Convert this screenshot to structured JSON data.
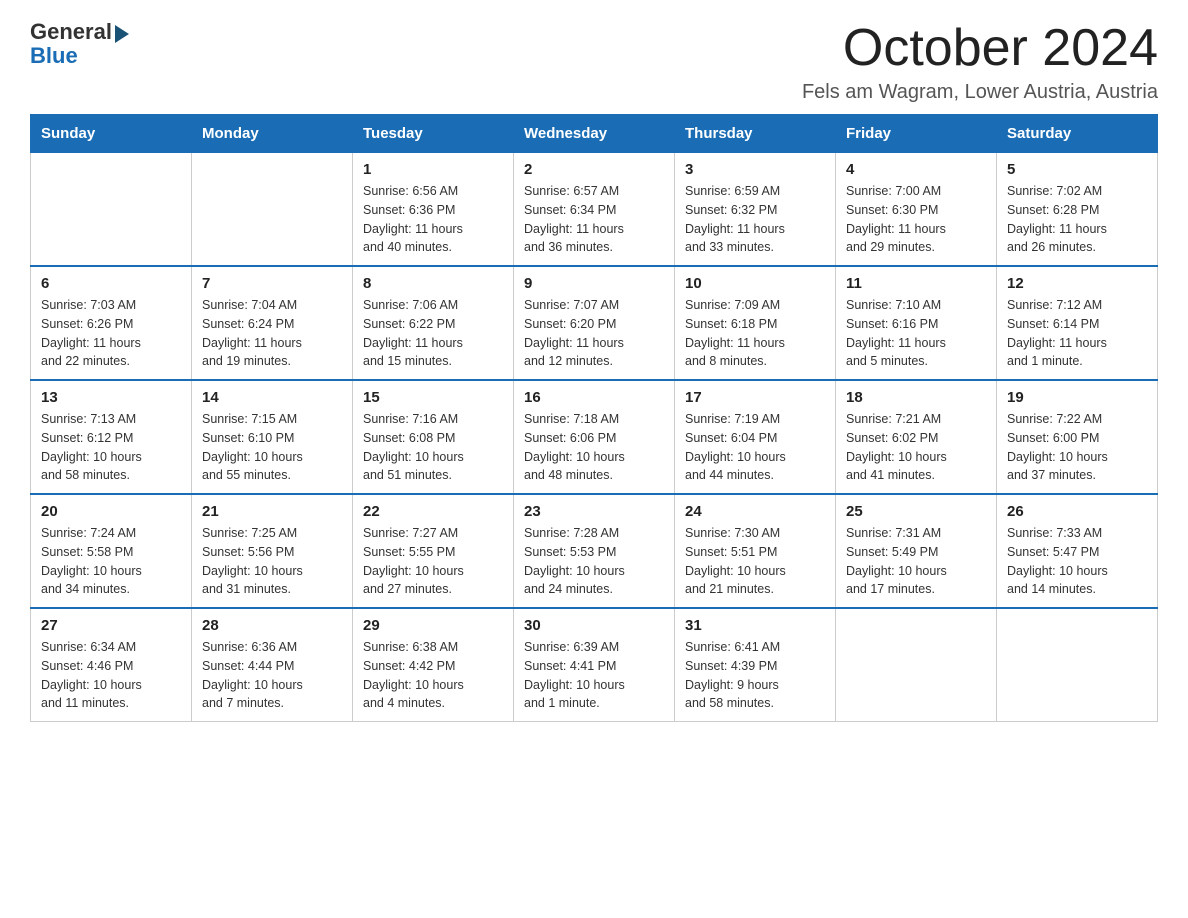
{
  "header": {
    "logo_general": "General",
    "logo_blue": "Blue",
    "month_title": "October 2024",
    "location": "Fels am Wagram, Lower Austria, Austria"
  },
  "days_of_week": [
    "Sunday",
    "Monday",
    "Tuesday",
    "Wednesday",
    "Thursday",
    "Friday",
    "Saturday"
  ],
  "weeks": [
    [
      {
        "day": "",
        "info": ""
      },
      {
        "day": "",
        "info": ""
      },
      {
        "day": "1",
        "info": "Sunrise: 6:56 AM\nSunset: 6:36 PM\nDaylight: 11 hours\nand 40 minutes."
      },
      {
        "day": "2",
        "info": "Sunrise: 6:57 AM\nSunset: 6:34 PM\nDaylight: 11 hours\nand 36 minutes."
      },
      {
        "day": "3",
        "info": "Sunrise: 6:59 AM\nSunset: 6:32 PM\nDaylight: 11 hours\nand 33 minutes."
      },
      {
        "day": "4",
        "info": "Sunrise: 7:00 AM\nSunset: 6:30 PM\nDaylight: 11 hours\nand 29 minutes."
      },
      {
        "day": "5",
        "info": "Sunrise: 7:02 AM\nSunset: 6:28 PM\nDaylight: 11 hours\nand 26 minutes."
      }
    ],
    [
      {
        "day": "6",
        "info": "Sunrise: 7:03 AM\nSunset: 6:26 PM\nDaylight: 11 hours\nand 22 minutes."
      },
      {
        "day": "7",
        "info": "Sunrise: 7:04 AM\nSunset: 6:24 PM\nDaylight: 11 hours\nand 19 minutes."
      },
      {
        "day": "8",
        "info": "Sunrise: 7:06 AM\nSunset: 6:22 PM\nDaylight: 11 hours\nand 15 minutes."
      },
      {
        "day": "9",
        "info": "Sunrise: 7:07 AM\nSunset: 6:20 PM\nDaylight: 11 hours\nand 12 minutes."
      },
      {
        "day": "10",
        "info": "Sunrise: 7:09 AM\nSunset: 6:18 PM\nDaylight: 11 hours\nand 8 minutes."
      },
      {
        "day": "11",
        "info": "Sunrise: 7:10 AM\nSunset: 6:16 PM\nDaylight: 11 hours\nand 5 minutes."
      },
      {
        "day": "12",
        "info": "Sunrise: 7:12 AM\nSunset: 6:14 PM\nDaylight: 11 hours\nand 1 minute."
      }
    ],
    [
      {
        "day": "13",
        "info": "Sunrise: 7:13 AM\nSunset: 6:12 PM\nDaylight: 10 hours\nand 58 minutes."
      },
      {
        "day": "14",
        "info": "Sunrise: 7:15 AM\nSunset: 6:10 PM\nDaylight: 10 hours\nand 55 minutes."
      },
      {
        "day": "15",
        "info": "Sunrise: 7:16 AM\nSunset: 6:08 PM\nDaylight: 10 hours\nand 51 minutes."
      },
      {
        "day": "16",
        "info": "Sunrise: 7:18 AM\nSunset: 6:06 PM\nDaylight: 10 hours\nand 48 minutes."
      },
      {
        "day": "17",
        "info": "Sunrise: 7:19 AM\nSunset: 6:04 PM\nDaylight: 10 hours\nand 44 minutes."
      },
      {
        "day": "18",
        "info": "Sunrise: 7:21 AM\nSunset: 6:02 PM\nDaylight: 10 hours\nand 41 minutes."
      },
      {
        "day": "19",
        "info": "Sunrise: 7:22 AM\nSunset: 6:00 PM\nDaylight: 10 hours\nand 37 minutes."
      }
    ],
    [
      {
        "day": "20",
        "info": "Sunrise: 7:24 AM\nSunset: 5:58 PM\nDaylight: 10 hours\nand 34 minutes."
      },
      {
        "day": "21",
        "info": "Sunrise: 7:25 AM\nSunset: 5:56 PM\nDaylight: 10 hours\nand 31 minutes."
      },
      {
        "day": "22",
        "info": "Sunrise: 7:27 AM\nSunset: 5:55 PM\nDaylight: 10 hours\nand 27 minutes."
      },
      {
        "day": "23",
        "info": "Sunrise: 7:28 AM\nSunset: 5:53 PM\nDaylight: 10 hours\nand 24 minutes."
      },
      {
        "day": "24",
        "info": "Sunrise: 7:30 AM\nSunset: 5:51 PM\nDaylight: 10 hours\nand 21 minutes."
      },
      {
        "day": "25",
        "info": "Sunrise: 7:31 AM\nSunset: 5:49 PM\nDaylight: 10 hours\nand 17 minutes."
      },
      {
        "day": "26",
        "info": "Sunrise: 7:33 AM\nSunset: 5:47 PM\nDaylight: 10 hours\nand 14 minutes."
      }
    ],
    [
      {
        "day": "27",
        "info": "Sunrise: 6:34 AM\nSunset: 4:46 PM\nDaylight: 10 hours\nand 11 minutes."
      },
      {
        "day": "28",
        "info": "Sunrise: 6:36 AM\nSunset: 4:44 PM\nDaylight: 10 hours\nand 7 minutes."
      },
      {
        "day": "29",
        "info": "Sunrise: 6:38 AM\nSunset: 4:42 PM\nDaylight: 10 hours\nand 4 minutes."
      },
      {
        "day": "30",
        "info": "Sunrise: 6:39 AM\nSunset: 4:41 PM\nDaylight: 10 hours\nand 1 minute."
      },
      {
        "day": "31",
        "info": "Sunrise: 6:41 AM\nSunset: 4:39 PM\nDaylight: 9 hours\nand 58 minutes."
      },
      {
        "day": "",
        "info": ""
      },
      {
        "day": "",
        "info": ""
      }
    ]
  ]
}
